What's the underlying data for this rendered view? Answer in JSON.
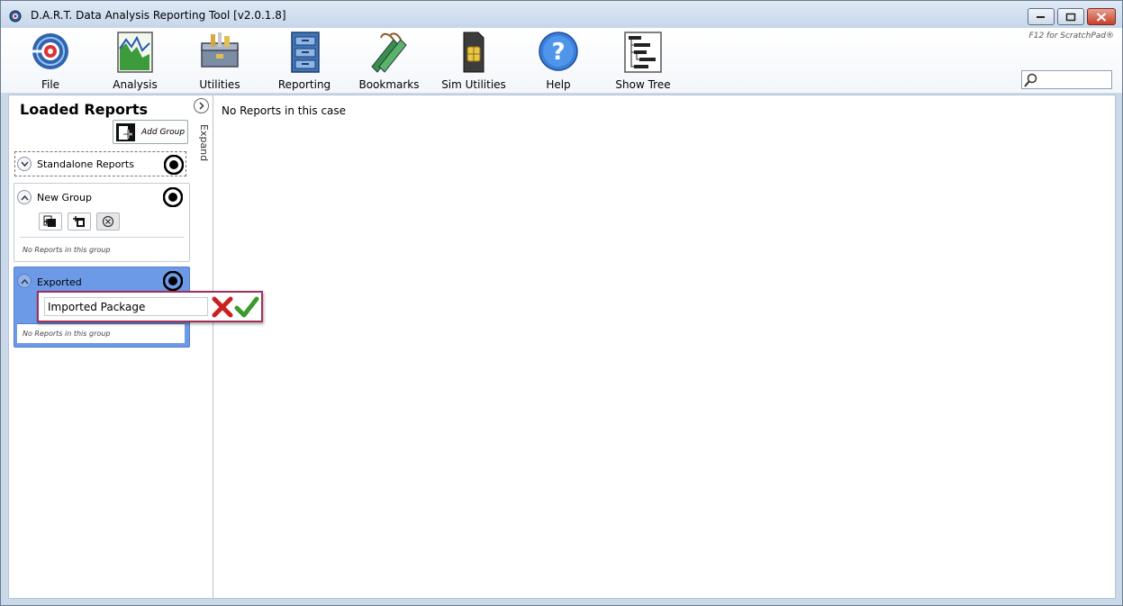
{
  "window": {
    "title": "D.A.R.T. Data Analysis Reporting Tool [v2.0.1.8]"
  },
  "toolbar": {
    "items": [
      {
        "label": "File",
        "icon": "file-disc-icon"
      },
      {
        "label": "Analysis",
        "icon": "analysis-chart-icon"
      },
      {
        "label": "Utilities",
        "icon": "toolbox-icon"
      },
      {
        "label": "Reporting",
        "icon": "filing-cabinet-icon"
      },
      {
        "label": "Bookmarks",
        "icon": "bookmarks-icon"
      },
      {
        "label": "Sim Utilities",
        "icon": "sim-card-icon"
      },
      {
        "label": "Help",
        "icon": "help-icon"
      },
      {
        "label": "Show Tree",
        "icon": "tree-icon"
      }
    ],
    "scratchpad_hint": "F12 for ScratchPad®",
    "search": {
      "value": "",
      "placeholder": ""
    }
  },
  "left_panel": {
    "title": "Loaded Reports",
    "expand_label": "Expand",
    "add_group_label": "Add Group",
    "groups": [
      {
        "name": "Standalone Reports"
      },
      {
        "name": "New Group",
        "empty_text": "No Reports in this group"
      },
      {
        "name": "Exported",
        "empty_text": "No Reports in this group"
      }
    ]
  },
  "rename_popup": {
    "value": "Imported Package"
  },
  "main": {
    "message": "No Reports in this case"
  },
  "colors": {
    "accent_selected_group": "#6d9ae6",
    "popup_border": "#a0305a",
    "cancel_red": "#cc2020",
    "ok_green": "#3a9a2a"
  }
}
